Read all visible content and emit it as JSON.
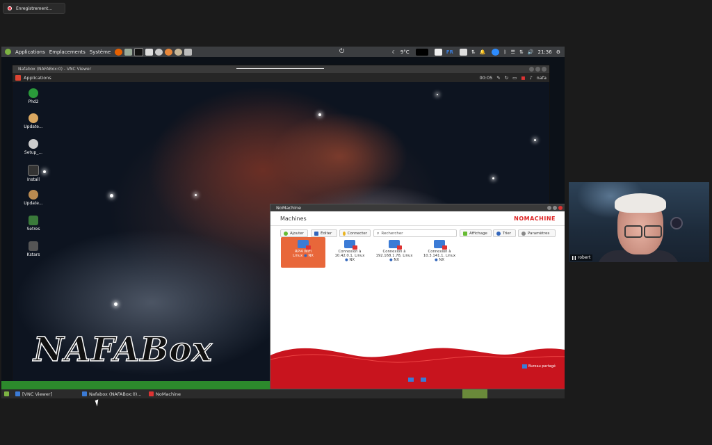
{
  "recording": {
    "label": "Enregistrement..."
  },
  "host_panel": {
    "menu": [
      "Applications",
      "Emplacements",
      "Système"
    ],
    "weather": "9°C",
    "lang": "FR",
    "clock": "21:36"
  },
  "vnc_window": {
    "title": "Nafabox (NAFABox:0) - VNC Viewer"
  },
  "remote_panel": {
    "apps_label": "Applications",
    "time": "00:05",
    "user": "nafa"
  },
  "desktop_icons": [
    "Phd2",
    "Update...",
    "Setup_...",
    "Install",
    "Update...",
    "Setres",
    "Kstars"
  ],
  "wallpaper_text": "NAFABox",
  "nomachine": {
    "title": "NoMachine",
    "heading": "Machines",
    "brand": "NOMACHINE",
    "toolbar": {
      "add": "Ajouter",
      "edit": "Éditer",
      "connect": "Connecter",
      "search_placeholder": "Rechercher",
      "display": "Affichage",
      "sort": "Trier",
      "settings": "Paramètres"
    },
    "machines": [
      {
        "line1": "RPi4 WiFi",
        "line2": "Linux",
        "tag": "NX",
        "selected": true
      },
      {
        "line1": "Connexion à",
        "line2": "10.42.0.1, Linux",
        "tag": "NX",
        "selected": false
      },
      {
        "line1": "Connexion à",
        "line2": "192.168.1.78, Linux",
        "tag": "NX",
        "selected": false
      },
      {
        "line1": "Connexion à",
        "line2": "10.3.141.1, Linux",
        "tag": "NX",
        "selected": false
      }
    ],
    "footer_label": "Bureau partagé"
  },
  "taskbar": [
    {
      "label": "[VNC Viewer]"
    },
    {
      "label": "Nafabox (NAFABox:0)..."
    },
    {
      "label": "NoMachine"
    }
  ],
  "webcam": {
    "name": "robert"
  },
  "colors": {
    "accent": "#e8673a",
    "nomachine_red": "#c8141e",
    "host_green": "#2c8a2c"
  }
}
